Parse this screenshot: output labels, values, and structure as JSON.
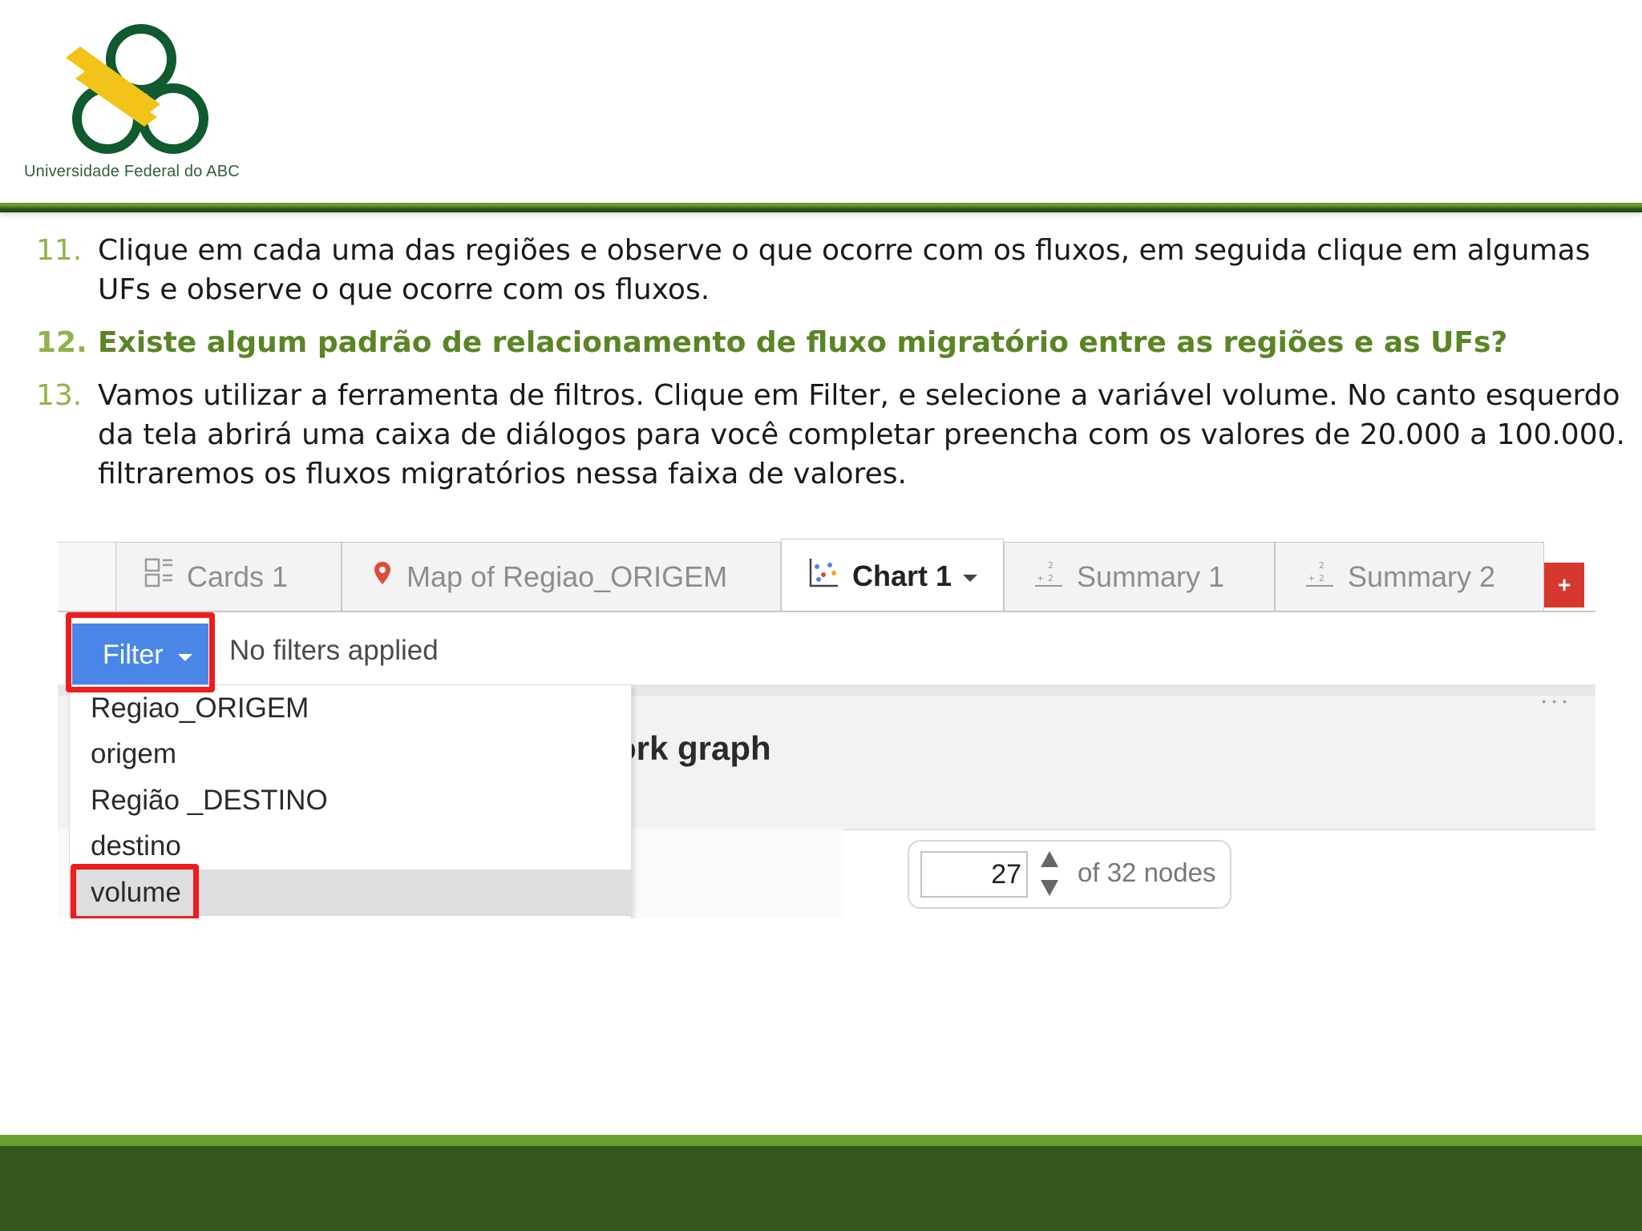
{
  "logo": {
    "name": "Universidade Federal do ABC",
    "colors": {
      "ring": "#0f5a2e",
      "wing": "#f2c318"
    }
  },
  "steps": [
    {
      "number": "11.",
      "text": "Clique em cada uma das regiões e observe o que ocorre com os fluxos, em seguida clique em algumas UFs e observe o que ocorre com os fluxos.",
      "bold": false
    },
    {
      "number": "12.",
      "text": "Existe algum padrão de relacionamento de fluxo migratório entre as regiões e as UFs?",
      "bold": true
    },
    {
      "number": "13.",
      "text": "Vamos utilizar a ferramenta de filtros. Clique em Filter, e selecione a variável volume. No canto esquerdo da tela abrirá uma caixa de diálogos para você completar preencha com os valores de 20.000 a 100.000. filtraremos os fluxos migratórios nessa faixa de valores.",
      "bold": false
    }
  ],
  "screenshot": {
    "tabs": [
      {
        "label": "Cards 1",
        "icon": "cards-icon",
        "active": false
      },
      {
        "label": "Map of Regiao_ORIGEM",
        "icon": "map-pin-icon",
        "active": false
      },
      {
        "label": "Chart 1",
        "icon": "scatter-chart-icon",
        "active": true
      },
      {
        "label": "Summary 1",
        "icon": "summary-icon",
        "active": false
      },
      {
        "label": "Summary 2",
        "icon": "summary-icon",
        "active": false
      }
    ],
    "add_tab_label": "+",
    "filter_button": "Filter",
    "filter_status": "No filters applied",
    "dropdown_items": [
      "Regiao_ORIGEM",
      "origem",
      "Região _DESTINO",
      "destino",
      "volume"
    ],
    "selected_item": "volume",
    "chart_title_fragment": "ork graph",
    "nodes_value": "27",
    "nodes_label": "of 32 nodes",
    "colors": {
      "filter_button": "#4a86e8",
      "highlight": "#ee1c1c",
      "add_tab": "#d7382d"
    }
  },
  "theme": {
    "accent": "#8fb34a",
    "footer": "#33561d",
    "footer_band": "#6aa12e"
  }
}
